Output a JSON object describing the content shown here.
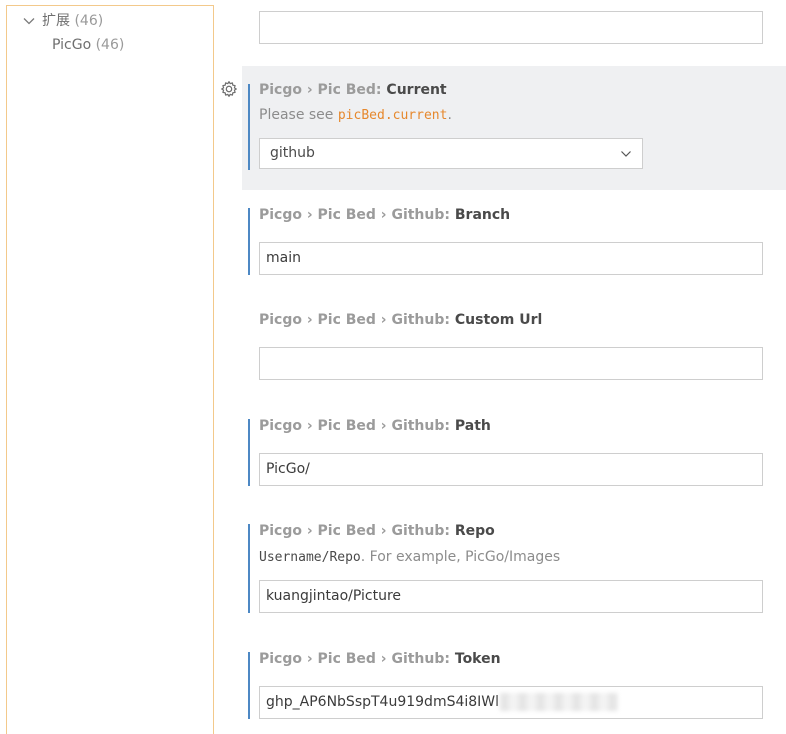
{
  "tree": {
    "extensions": {
      "label": "扩展",
      "count": "(46)"
    },
    "picgo": {
      "label": "PicGo",
      "count": "(46)"
    }
  },
  "settings": {
    "top_input_value": "",
    "current": {
      "prefix": "Picgo › Pic Bed: ",
      "key": "Current",
      "desc_before": "Please see ",
      "desc_code": "picBed.current",
      "desc_after": ".",
      "value": "github"
    },
    "branch": {
      "prefix": "Picgo › Pic Bed › Github: ",
      "key": "Branch",
      "value": "main"
    },
    "custom_url": {
      "prefix": "Picgo › Pic Bed › Github: ",
      "key": "Custom Url",
      "value": ""
    },
    "path": {
      "prefix": "Picgo › Pic Bed › Github: ",
      "key": "Path",
      "value": "PicGo/"
    },
    "repo": {
      "prefix": "Picgo › Pic Bed › Github: ",
      "key": "Repo",
      "desc_code": "Username/Repo",
      "desc_after": ". For example, PicGo/Images",
      "value": "kuangjintao/Picture"
    },
    "token": {
      "prefix": "Picgo › Pic Bed › Github: ",
      "key": "Token",
      "value": "ghp_AP6NbSspT4u919dmS4i8IWl"
    }
  },
  "colors": {
    "tree_border": "#f3c98b",
    "modified_bar": "#4d88c4",
    "focused_bg": "#eff0f2",
    "code_accent": "#e6882d"
  },
  "icons": {
    "tree_chevron": "chevron-down-icon",
    "gear": "gear-icon",
    "select_chevron": "chevron-down-icon"
  }
}
